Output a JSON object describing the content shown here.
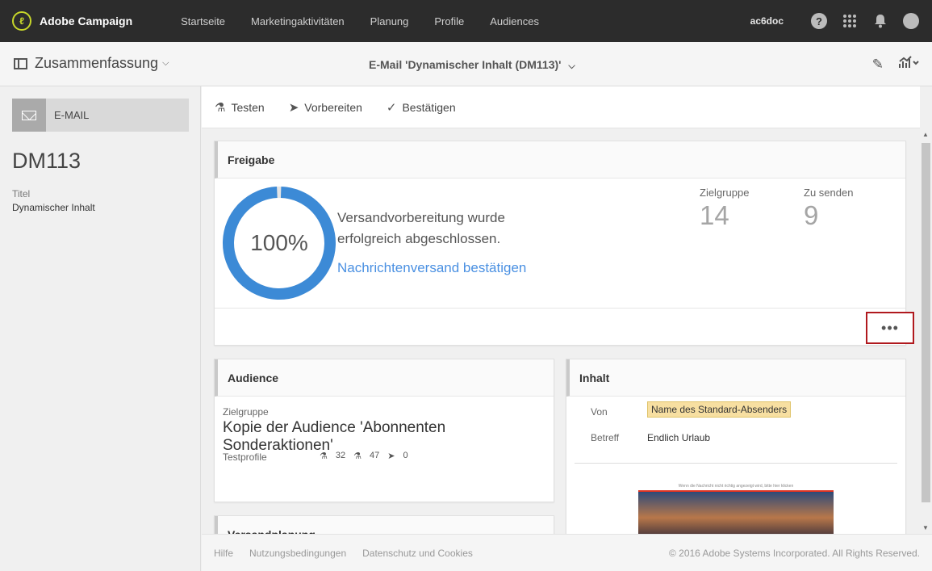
{
  "app": {
    "name": "Adobe Campaign",
    "logo_glyph": "ℓ"
  },
  "nav": [
    "Startseite",
    "Marketingaktivitäten",
    "Planung",
    "Profile",
    "Audiences"
  ],
  "user": {
    "name": "ac6doc",
    "help_glyph": "?"
  },
  "subheader": {
    "view": "Zusammenfassung",
    "delivery": "E-Mail 'Dynamischer Inhalt (DM113)'"
  },
  "left": {
    "channel": "E-MAIL",
    "id": "DM113",
    "title_label": "Titel",
    "title_value": "Dynamischer Inhalt"
  },
  "toolbar": {
    "test": "Testen",
    "prepare": "Vorbereiten",
    "confirm": "Bestätigen"
  },
  "approval": {
    "heading": "Freigabe",
    "progress": 100,
    "progress_label": "100%",
    "status": "Versandvorbereitung wurde erfolgreich abgeschlossen.",
    "link": "Nachrichtenversand bestätigen",
    "target_label": "Zielgruppe",
    "target_value": "14",
    "tosend_label": "Zu senden",
    "tosend_value": "9",
    "more": "•••",
    "ring_color": "#3c8ad6"
  },
  "audience": {
    "heading": "Audience",
    "target_label": "Zielgruppe",
    "target_value": "Kopie der Audience 'Abonnenten Sonderaktionen'",
    "test_label": "Testprofile",
    "counts": [
      "32",
      "47",
      "0"
    ]
  },
  "content": {
    "heading": "Inhalt",
    "from_label": "Von",
    "from_value": "Name des Standard-Absenders",
    "subject_label": "Betreff",
    "subject_value": "Endlich Urlaub",
    "preview_note": "Wenn die Nachricht nicht richtig angezeigt wird, bitte hier klicken"
  },
  "shipping": {
    "heading": "Versandplanung"
  },
  "footer": {
    "help": "Hilfe",
    "terms": "Nutzungsbedingungen",
    "privacy": "Datenschutz und Cookies",
    "copyright": "© 2016 Adobe Systems Incorporated. All Rights Reserved."
  }
}
